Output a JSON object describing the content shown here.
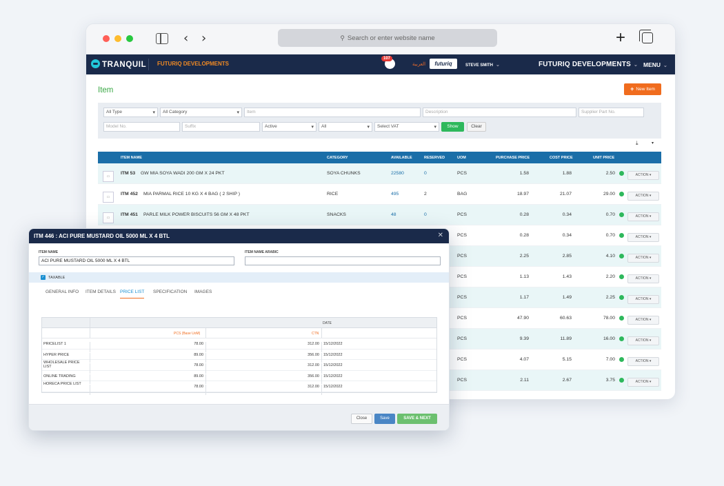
{
  "browser": {
    "url_placeholder": "Search or enter website name",
    "back": "‹",
    "forward": "›",
    "new_tab": "+"
  },
  "app": {
    "logo_text": "TRANQUIL",
    "company": "FUTURIQ DEVELOPMENTS",
    "notification_count": "107",
    "arabic_label": "العربية",
    "partner_logo": "futuriq",
    "user": "STEVE SMITH",
    "right_company": "FUTURIQ DEVELOPMENTS",
    "menu": "MENU",
    "caret": "⌄"
  },
  "page": {
    "title": "Item",
    "new_button": "New Item",
    "new_plus": "+"
  },
  "filters": {
    "type": "All Type",
    "category": "All Category",
    "item_placeholder": "Item",
    "description_placeholder": "Description",
    "supplier_placeholder": "Supplier Part No.",
    "model_placeholder": "Model No.",
    "suffix_placeholder": "Suffix",
    "status": "Active",
    "all": "All",
    "vat": "Select VAT",
    "show": "Show",
    "clear": "Clear"
  },
  "export": {
    "icon": "⤓",
    "caret": "▾"
  },
  "table": {
    "headers": {
      "item_name": "ITEM NAME",
      "category": "CATEGORY",
      "available": "AVAILABLE",
      "reserved": "RESERVED",
      "uom": "UOM",
      "purchase_price": "PURCHASE PRICE",
      "cost_price": "COST PRICE",
      "unit_price": "UNIT PRICE"
    },
    "action_label": "ACTION ▾",
    "thumb": "▭",
    "rows": [
      {
        "code": "ITM 53",
        "name": "GW MIA SOYA WADI 200 GM X 24 PKT",
        "category": "SOYA CHUNKS",
        "available": "22580",
        "reserved": "0",
        "uom": "PCS",
        "purchase": "1.58",
        "cost": "1.88",
        "unit": "2.50"
      },
      {
        "code": "ITM 452",
        "name": "MIA PARMAL RICE 10 KG X 4 BAG ( 2 SHIP )",
        "category": "RICE",
        "available": "495",
        "reserved": "2",
        "uom": "BAG",
        "purchase": "18.97",
        "cost": "21.07",
        "unit": "29.00"
      },
      {
        "code": "ITM 451",
        "name": "PARLE MILK POWER BISCUITS 56 GM X 48 PKT",
        "category": "SNACKS",
        "available": "48",
        "reserved": "0",
        "uom": "PCS",
        "purchase": "0.28",
        "cost": "0.34",
        "unit": "0.70"
      },
      {
        "code": "",
        "name": "",
        "category": "",
        "available": "",
        "reserved": "",
        "uom": "PCS",
        "purchase": "0.28",
        "cost": "0.34",
        "unit": "0.70"
      },
      {
        "code": "",
        "name": "",
        "category": "",
        "available": "",
        "reserved": "",
        "uom": "PCS",
        "purchase": "2.25",
        "cost": "2.85",
        "unit": "4.10"
      },
      {
        "code": "",
        "name": "",
        "category": "",
        "available": "",
        "reserved": "",
        "uom": "PCS",
        "purchase": "1.13",
        "cost": "1.43",
        "unit": "2.20"
      },
      {
        "code": "",
        "name": "",
        "category": "",
        "available": "",
        "reserved": "",
        "uom": "PCS",
        "purchase": "1.17",
        "cost": "1.49",
        "unit": "2.25"
      },
      {
        "code": "",
        "name": "",
        "category": "",
        "available": "",
        "reserved": "",
        "uom": "PCS",
        "purchase": "47.90",
        "cost": "60.63",
        "unit": "78.00"
      },
      {
        "code": "",
        "name": "",
        "category": "",
        "available": "",
        "reserved": "",
        "uom": "PCS",
        "purchase": "9.39",
        "cost": "11.89",
        "unit": "16.00"
      },
      {
        "code": "",
        "name": "",
        "category": "",
        "available": "",
        "reserved": "",
        "uom": "PCS",
        "purchase": "4.07",
        "cost": "5.15",
        "unit": "7.00"
      },
      {
        "code": "",
        "name": "",
        "category": "",
        "available": "",
        "reserved": "",
        "uom": "PCS",
        "purchase": "2.11",
        "cost": "2.67",
        "unit": "3.75"
      }
    ]
  },
  "modal": {
    "title": "ITM 446 : ACI PURE MUSTARD OIL 5000 ML X 4 BTL",
    "close": "✕",
    "item_name_label": "ITEM NAME",
    "item_name_value": "ACI PURE MUSTARD OIL 5000 ML X 4 BTL",
    "item_name_arabic_label": "ITEM NAME ARABIC",
    "item_name_arabic_value": "",
    "taxable_label": "TAXABLE",
    "taxable_check": "✓",
    "tabs": [
      "GENERAL INFO",
      "ITEM DETAILS",
      "PRICE LIST",
      "SPECIFICATION",
      "IMAGES"
    ],
    "active_tab": 2,
    "price_list": {
      "date_header": "DATE",
      "pcs_header": "PCS (Base UoM)",
      "ctn_header": "CTN",
      "rows": [
        {
          "name": "PRICELIST 1",
          "pcs": "78.00",
          "ctn": "312.00",
          "date": "15/12/2022"
        },
        {
          "name": "HYPER PRICE",
          "pcs": "89.00",
          "ctn": "356.00",
          "date": "15/12/2022"
        },
        {
          "name": "WHOLESALE PRICE LIST",
          "pcs": "78.00",
          "ctn": "312.00",
          "date": "15/12/2022"
        },
        {
          "name": "ONLINE TRADING",
          "pcs": "89.00",
          "ctn": "356.00",
          "date": "15/12/2022"
        },
        {
          "name": "HORECA PRICE LIST",
          "pcs": "78.00",
          "ctn": "312.00",
          "date": "15/12/2022"
        }
      ]
    },
    "buttons": {
      "close": "Close",
      "save": "Save",
      "save_next": "SAVE & NEXT"
    }
  },
  "colors": {
    "header_navy": "#1a2a4a",
    "table_blue": "#1a6ea8",
    "accent_orange": "#f06c1e",
    "success_green": "#2eb85c",
    "title_green": "#3aa845"
  }
}
